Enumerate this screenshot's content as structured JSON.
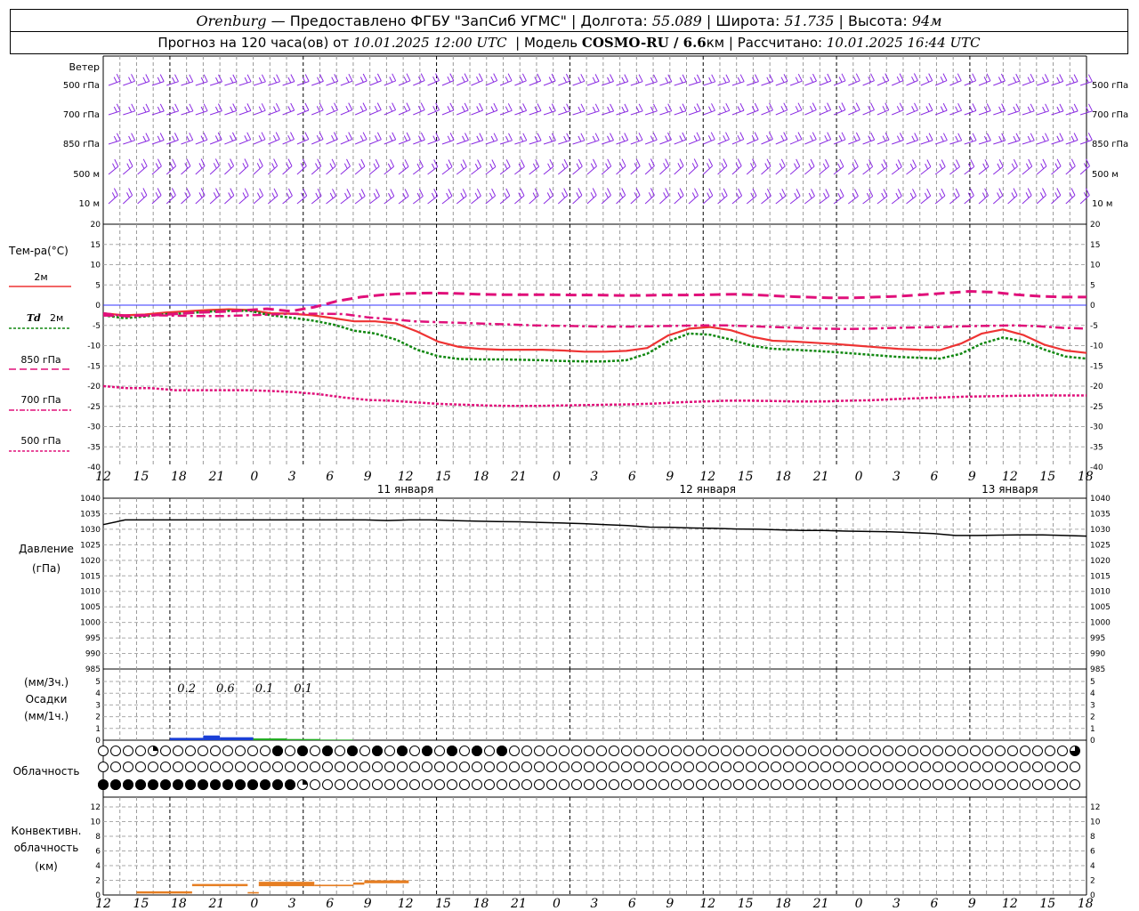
{
  "header": {
    "city": "Orenburg",
    "provider": "— Предоставлено ФГБУ \"ЗапСиб УГМС\"",
    "lon_label": "Долгота:",
    "lon": "55.089",
    "lat_label": "Широта:",
    "lat": "51.735",
    "alt_label": "Высота:",
    "alt": "94м",
    "forecast_label": "Прогноз на 120 часа(ов) от",
    "forecast_from": "10.01.2025 12:00 UTC",
    "model_label": "Модель",
    "model": "COSMO-RU / 6.6",
    "model_unit": "км",
    "calc_label": "Рассчитано:",
    "calc": "10.01.2025 16:44 UTC",
    "sep": "|"
  },
  "labels": {
    "wind": "Ветер",
    "wind_levels": [
      "500 гПа",
      "700 гПа",
      "850 гПа",
      "500 м",
      "10 м"
    ],
    "temp": "Тем-ра(°С)",
    "t2m": "2м",
    "td": "Td",
    "td_2m": "2м",
    "t850": "850 гПа",
    "t700": "700 гПа",
    "t500": "500 гПа",
    "pressure": "Давление",
    "pressure_unit": "(гПа)",
    "precip_unit1": "(мм/3ч.)",
    "precip": "Осадки",
    "precip_unit2": "(мм/1ч.)",
    "cloud": "Облачность",
    "conv1": "Конвективн.",
    "conv2": "облачность",
    "conv3": "(км)"
  },
  "colors": {
    "t2m": "#ee3333",
    "td": "#118811",
    "t850": "#e0107a",
    "wind": "#8a2be2",
    "pressure": "#000000",
    "precip_blue": "#1a3fd6",
    "precip_green": "#22aa22",
    "conv": "#e67e22",
    "zero_line": "#3333ff"
  },
  "chart_data": [
    {
      "type": "line",
      "title": "Тем-ра(°С)",
      "x_hours": [
        0,
        3,
        6,
        9,
        12,
        15,
        18,
        21,
        24,
        27,
        30,
        33,
        36,
        39,
        42,
        45,
        48,
        51,
        54,
        57,
        60,
        63,
        66,
        69,
        72,
        75,
        78,
        81,
        84,
        87,
        90,
        93,
        96,
        99,
        102,
        105,
        108,
        111,
        114,
        117,
        120,
        123,
        126,
        129,
        132,
        135,
        138,
        141,
        144,
        147,
        150,
        153,
        156,
        159,
        162,
        165,
        168,
        171,
        174,
        177
      ],
      "ylim": [
        -40,
        20
      ],
      "yticks": [
        20,
        15,
        10,
        5,
        0,
        -5,
        -10,
        -15,
        -20,
        -25,
        -30,
        -35,
        -40
      ],
      "series": [
        {
          "name": "2м",
          "values": [
            -2,
            -2.5,
            -2.3,
            -1.8,
            -1.5,
            -1.2,
            -1,
            -1.2,
            -2,
            -2.1,
            -2.5,
            -3.2,
            -4,
            -4,
            -4.5,
            -6.5,
            -9,
            -10.3,
            -10.8,
            -11,
            -11,
            -11,
            -11.2,
            -11.5,
            -11.5,
            -11.3,
            -10.6,
            -7.5,
            -5.8,
            -5.4,
            -6.2,
            -7.8,
            -8.8,
            -9,
            -9.3,
            -9.6,
            -10,
            -10.4,
            -10.8,
            -11,
            -11.1,
            -9.5,
            -7,
            -6,
            -7.4,
            -9.8,
            -11.2,
            -11.8
          ]
        },
        {
          "name": "Td 2м",
          "values": [
            -2.5,
            -3.2,
            -2.8,
            -2.2,
            -2,
            -1.6,
            -1.4,
            -1.4,
            -2.5,
            -3.1,
            -3.8,
            -4.8,
            -6.3,
            -7,
            -8.5,
            -11,
            -12.6,
            -13.3,
            -13.4,
            -13.4,
            -13.5,
            -13.6,
            -13.8,
            -13.9,
            -13.9,
            -13.6,
            -12,
            -9,
            -7,
            -7.3,
            -8.5,
            -10,
            -10.8,
            -11,
            -11.3,
            -11.6,
            -12,
            -12.4,
            -12.8,
            -13,
            -13.2,
            -12,
            -9.5,
            -8,
            -9,
            -11,
            -12.7,
            -13.2
          ]
        },
        {
          "name": "850 гПа",
          "values": [
            -2.5,
            -2.6,
            -2.5,
            -2.2,
            -1.8,
            -1.6,
            -1.3,
            -0.9,
            -1.5,
            -0.5,
            1,
            2,
            2.6,
            2.9,
            3,
            2.9,
            2.7,
            2.6,
            2.6,
            2.6,
            2.5,
            2.5,
            2.4,
            2.4,
            2.5,
            2.5,
            2.6,
            2.7,
            2.5,
            2.2,
            2,
            1.8,
            1.8,
            2,
            2.2,
            2.6,
            3,
            3.4,
            3.2,
            2.6,
            2.2,
            2,
            2
          ]
        },
        {
          "name": "700 гПа",
          "values": [
            -2,
            -2.8,
            -2.5,
            -2.6,
            -2.7,
            -2.7,
            -2.5,
            -2.3,
            -2.1,
            -2.1,
            -2.2,
            -3,
            -3.5,
            -4,
            -4.2,
            -4.4,
            -4.6,
            -4.8,
            -5,
            -5.1,
            -5.2,
            -5.3,
            -5.3,
            -5.2,
            -5.1,
            -5,
            -5,
            -5.2,
            -5.4,
            -5.6,
            -5.8,
            -5.9,
            -5.8,
            -5.6,
            -5.5,
            -5.4,
            -5.2,
            -5.1,
            -5,
            -5.2,
            -5.6,
            -5.8
          ]
        },
        {
          "name": "500 гПа",
          "values": [
            -20,
            -20.5,
            -20.5,
            -21,
            -21,
            -21,
            -21,
            -21.2,
            -21.5,
            -22,
            -22.8,
            -23.4,
            -23.6,
            -24,
            -24.4,
            -24.6,
            -24.8,
            -24.9,
            -24.9,
            -24.8,
            -24.7,
            -24.6,
            -24.5,
            -24.3,
            -24,
            -23.8,
            -23.6,
            -23.6,
            -23.7,
            -23.8,
            -23.8,
            -23.6,
            -23.5,
            -23.2,
            -23,
            -22.8,
            -22.6,
            -22.5,
            -22.4,
            -22.3,
            -22.3,
            -22.3
          ]
        }
      ]
    },
    {
      "type": "line",
      "title": "Давление",
      "ylabel": "(гПа)",
      "ylim": [
        985,
        1040
      ],
      "yticks": [
        1040,
        1035,
        1030,
        1025,
        1020,
        1015,
        1010,
        1005,
        1000,
        995,
        990,
        985
      ],
      "series": [
        {
          "name": "Давление",
          "values": [
            1031.5,
            1033,
            1033,
            1033,
            1033,
            1033,
            1033,
            1033,
            1033,
            1033,
            1033,
            1033,
            1033,
            1032.8,
            1033,
            1033,
            1032.8,
            1032.6,
            1032.5,
            1032.4,
            1032.2,
            1032,
            1031.8,
            1031.5,
            1031.2,
            1030.7,
            1030.6,
            1030.4,
            1030.3,
            1030.1,
            1030,
            1029.8,
            1029.6,
            1029.6,
            1029.4,
            1029.3,
            1029.2,
            1028.9,
            1028.6,
            1028,
            1028,
            1028.1,
            1028.2,
            1028.2,
            1028,
            1027.8
          ]
        }
      ]
    },
    {
      "type": "bar",
      "title": "Осадки",
      "ylim": [
        0,
        5
      ],
      "yticks": [
        5,
        4,
        3,
        2,
        1,
        0
      ],
      "labels_3h": [
        "0.2",
        "0.6",
        "0.1",
        "0.1"
      ],
      "bars_1h": [
        {
          "h0": 12,
          "h1": 18,
          "value": 0.2,
          "color": "blue"
        },
        {
          "h0": 18,
          "h1": 21,
          "value": 0.4,
          "color": "blue"
        },
        {
          "h0": 21,
          "h1": 27,
          "value": 0.25,
          "color": "blue"
        },
        {
          "h0": 27,
          "h1": 33,
          "value": 0.15,
          "color": "green"
        },
        {
          "h0": 33,
          "h1": 39,
          "value": 0.1,
          "color": "green"
        },
        {
          "h0": 39,
          "h1": 45,
          "value": 0.05,
          "color": "green"
        }
      ]
    },
    {
      "type": "bar",
      "title": "Конвективн. облачность (км)",
      "ylim": [
        0,
        13
      ],
      "yticks": [
        12,
        10,
        8,
        6,
        4,
        2,
        0
      ],
      "segments": [
        {
          "h0": 6,
          "h1": 16,
          "bottom": 0.2,
          "top": 0.5
        },
        {
          "h0": 16,
          "h1": 26,
          "bottom": 1.2,
          "top": 1.5
        },
        {
          "h0": 26,
          "h1": 28,
          "bottom": 0.2,
          "top": 0.4
        },
        {
          "h0": 28,
          "h1": 38,
          "bottom": 1.2,
          "top": 1.8
        },
        {
          "h0": 38,
          "h1": 45,
          "bottom": 1.2,
          "top": 1.4
        },
        {
          "h0": 45,
          "h1": 47,
          "bottom": 1.4,
          "top": 1.7
        },
        {
          "h0": 47,
          "h1": 55,
          "bottom": 1.6,
          "top": 2
        }
      ]
    }
  ],
  "time_axis": {
    "hour_labels": [
      "12",
      "15",
      "18",
      "21",
      "0",
      "3",
      "6",
      "9",
      "12",
      "15",
      "18",
      "21",
      "0",
      "3",
      "6",
      "9",
      "12",
      "15",
      "18",
      "21",
      "0",
      "3",
      "6",
      "9",
      "12",
      "15",
      "18"
    ],
    "dates": [
      "11 января",
      "12 января",
      "13 января"
    ]
  },
  "cloud_rows": {
    "high": "0000300000000040404040404040404040000000000000000000000000000000000000000000006000000000000000000000000000000000000",
    "mid": "0000000000000000000000000000000000000000000000000000000000000000000000000000000000000000000000000000000000000000",
    "low": "4444444444444444300000000000000000000000000000000000000000000000000000000000000000000000000000000000000000000000"
  }
}
